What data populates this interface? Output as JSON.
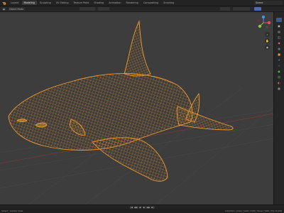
{
  "app": {
    "logo_icon": "blender-logo-icon",
    "workspace_tabs": [
      "Layout",
      "Modeling",
      "Sculpting",
      "UV Editing",
      "Texture Paint",
      "Shading",
      "Animation",
      "Rendering",
      "Compositing",
      "Scripting"
    ],
    "active_tab_index": 1,
    "scene_name": "Scene"
  },
  "viewport": {
    "mode_label": "Object Mode",
    "shading": "wireframe",
    "wire_color": "#f39a2b",
    "background_color": "#3d3d3d",
    "grid_color": "#4a4a4a",
    "gizmo": {
      "x": "#e84a5f",
      "y": "#8bc34a",
      "z": "#4a90e2"
    }
  },
  "timeline": {
    "buttons": [
      "|◀",
      "◀◀",
      "◀",
      "▶",
      "▶▶",
      "▶|"
    ]
  },
  "status": {
    "left": "Select · Center View",
    "right": "Collection | Cube | Verts 7,654 | Faces 7,620 | Tris 15,240"
  }
}
